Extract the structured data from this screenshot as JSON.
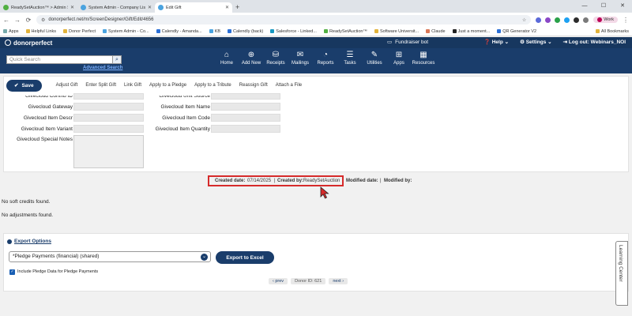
{
  "browser": {
    "tabs": [
      {
        "title": "ReadySetAuction™ > Admin S",
        "active": false
      },
      {
        "title": "System Admin - Company List",
        "active": false
      },
      {
        "title": "Edit Gift",
        "active": true
      }
    ],
    "new_tab": "+",
    "url": "donorperfect.net/m/ScreenDesigner/Gift/Edit/4656",
    "profile": "Work",
    "bookmarks": [
      "Apps",
      "Helpful Links",
      "Donor Perfect",
      "System Admin - Co...",
      "Calendly - Amanda...",
      "KB",
      "Calendly (back)",
      "Salesforce - Linked...",
      "ReadySetAuction™",
      "Software Universit...",
      "Claude",
      "Just a moment...",
      "QR Generator V2"
    ],
    "all_bookmarks": "All Bookmarks"
  },
  "header": {
    "logo": "donorperfect",
    "fundraiser_bot": "Fundraiser bot",
    "help": "Help",
    "settings": "Settings",
    "logout": "Log out: Webinars_NOI",
    "quick_search_placeholder": "Quick Search",
    "advanced_search": "Advanced Search",
    "nav": [
      "Home",
      "Add New",
      "Receipts",
      "Mailings",
      "Reports",
      "Tasks",
      "Utilities",
      "Apps",
      "Resources"
    ]
  },
  "toolbar": {
    "save": "Save",
    "actions": [
      "Adjust Gift",
      "Enter Split Gift",
      "Link Gift",
      "Apply to a Pledge",
      "Apply to a Tribute",
      "Reassign Gift",
      "Attach a File"
    ]
  },
  "fields": {
    "left": [
      "Givecloud Contrib ID",
      "Givecloud Gateway",
      "Givecloud Item Descr",
      "Givecloud Item Variant",
      "Givecloud Special Notes"
    ],
    "right": [
      "Givecloud Unit Source",
      "Givecloud Item Name",
      "Givecloud Item Code",
      "Givecloud Item Quantity"
    ]
  },
  "audit": {
    "created_date_label": "Created date:",
    "created_date": "07/14/2025",
    "sep": "|",
    "created_by_label": "Created by:",
    "created_by": "ReadySetAuction",
    "modified_date_label": "Modified date:",
    "modified_by_label": "Modified by:"
  },
  "messages": {
    "soft_credits": "No soft credits found.",
    "adjustments": "No adjustments found."
  },
  "export": {
    "title": "Export Options",
    "selected_option": "*Pledge Payments (financial) (shared)",
    "button": "Export to Excel",
    "checkbox_label": "Include Pledge Data for Pledge Payments",
    "checkbox_checked": true
  },
  "pager": {
    "prev": "‹ prev",
    "donor_id": "Donor ID: 621",
    "next": "next ›"
  },
  "learning_center": "Learning Center",
  "colors": {
    "brand": "#1a3d6b",
    "highlight": "#d62b2b"
  }
}
